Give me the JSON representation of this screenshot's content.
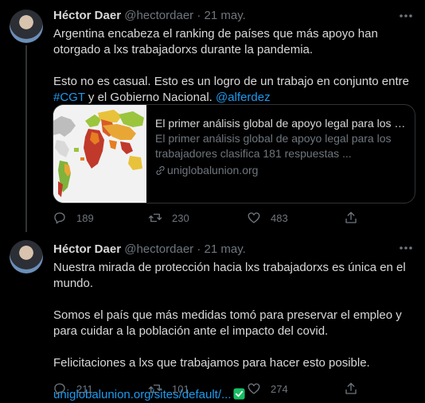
{
  "tweets": [
    {
      "name": "Héctor Daer",
      "handle": "@hectordaer",
      "sep": " · ",
      "time": "21 may.",
      "text1": "Argentina encabeza el ranking de países que más apoyo han otorgado a lxs trabajadorxs durante la pandemia.",
      "text2a": "Esto no es casual. Esto es un logro de un trabajo en conjunto entre ",
      "hashtag": "#CGT",
      "text2b": " y el Gobierno Nacional. ",
      "mention": "@alferdez",
      "card": {
        "title": "El primer análisis global de apoyo legal para los tra...",
        "description": "El primer análisis global de apoyo legal para los trabajadores clasifica 181 respuestas ...",
        "domain": "uniglobalunion.org"
      },
      "replies": "189",
      "retweets": "230",
      "likes": "483"
    },
    {
      "name": "Héctor Daer",
      "handle": "@hectordaer",
      "sep": " · ",
      "time": "21 may.",
      "p1": "Nuestra mirada de protección hacia lxs trabajadorxs es única en el mundo.",
      "p2": "Somos el país que más medidas tomó para preservar el empleo y para cuidar a la población ante el impacto del covid.",
      "p3": "Felicitaciones a lxs que trabajamos para hacer esto posible.",
      "url": "uniglobalunion.org/sites/default/...",
      "replies": "211",
      "retweets": "101",
      "likes": "274"
    }
  ],
  "colors": {
    "background": "#000000",
    "accent": "#1d9bf0",
    "muted": "#6e767d",
    "check": "#17bf63"
  },
  "icons": [
    "reply-icon",
    "retweet-icon",
    "like-icon",
    "share-icon",
    "more-icon",
    "link-icon",
    "check-icon"
  ]
}
